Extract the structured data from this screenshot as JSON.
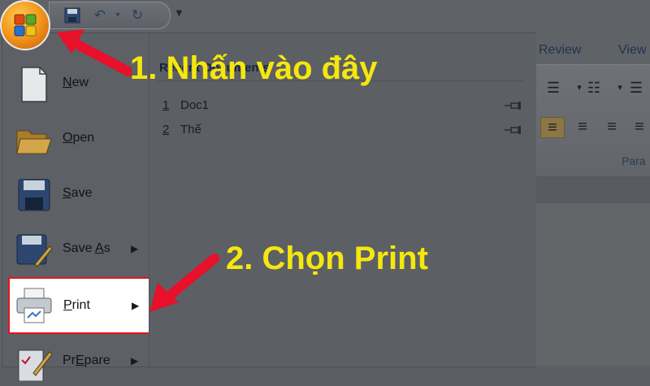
{
  "ribbon": {
    "tabs": [
      "Review",
      "View"
    ],
    "group_label": "Para"
  },
  "menu": {
    "recent_header": "Recent Documents",
    "recent": [
      {
        "num": "1",
        "name": "Doc1"
      },
      {
        "num": "2",
        "name": "Thế"
      }
    ],
    "items": [
      {
        "label": "New",
        "key": "N",
        "rest": "ew"
      },
      {
        "label": "Open",
        "key": "O",
        "rest": "pen"
      },
      {
        "label": "Save",
        "key": "S",
        "rest": "ave"
      },
      {
        "label": "Save As",
        "key": "A",
        "pre": "Save ",
        "rest": "s"
      },
      {
        "label": "Print",
        "key": "P",
        "rest": "rint"
      },
      {
        "label": "Prepare",
        "key": "E",
        "pre": "Pr",
        "rest": "pare"
      }
    ]
  },
  "annotations": {
    "step1": "1. Nhấn vào đây",
    "step2": "2. Chọn Print"
  },
  "colors": {
    "highlight": "#f5e70d",
    "arrow": "#e8102a",
    "box": "#e2131b"
  },
  "icons": [
    "office-button-icon",
    "save-icon",
    "undo-icon",
    "redo-icon",
    "customize-icon",
    "new-doc-icon",
    "open-folder-icon",
    "save-disk-icon",
    "save-as-icon",
    "printer-icon",
    "prepare-icon",
    "pin-icon"
  ]
}
